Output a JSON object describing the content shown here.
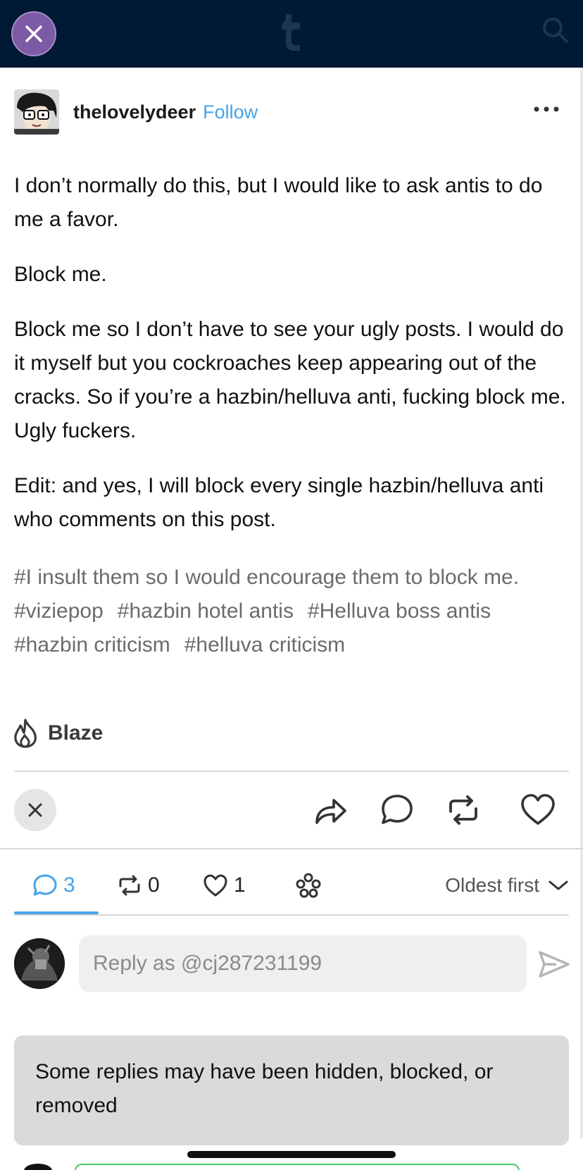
{
  "colors": {
    "topbar": "#001935",
    "accent_blue": "#45a4ea",
    "close_purple": "#7c5aa6",
    "notice_bg": "#dadada"
  },
  "topbar": {
    "close_icon": "close-icon",
    "logo_icon": "tumblr-logo-icon",
    "search_icon": "search-icon"
  },
  "post": {
    "username": "thelovelydeer",
    "follow_label": "Follow",
    "paragraphs": [
      "I don’t normally do this, but I would like to ask antis to do me a favor.",
      "Block me.",
      "Block me so I don’t have to see your ugly posts. I would do it myself but you cockroaches keep appearing out of the cracks. So if you’re a hazbin/helluva anti, fucking block me. Ugly fuckers.",
      "Edit: and yes, I will block every single hazbin/helluva anti who comments on this post."
    ],
    "tags": [
      "#I insult them so I would encourage them to block me.",
      "#viziepop",
      "#hazbin hotel antis",
      "#Helluva boss antis",
      "#hazbin criticism",
      "#helluva criticism"
    ],
    "blaze_label": "Blaze"
  },
  "notes": {
    "comments_count": "3",
    "reblogs_count": "0",
    "likes_count": "1",
    "sort_label": "Oldest first"
  },
  "reply": {
    "placeholder": "Reply as @cj287231199"
  },
  "notice": {
    "text": "Some replies may have been hidden, blocked, or removed"
  }
}
